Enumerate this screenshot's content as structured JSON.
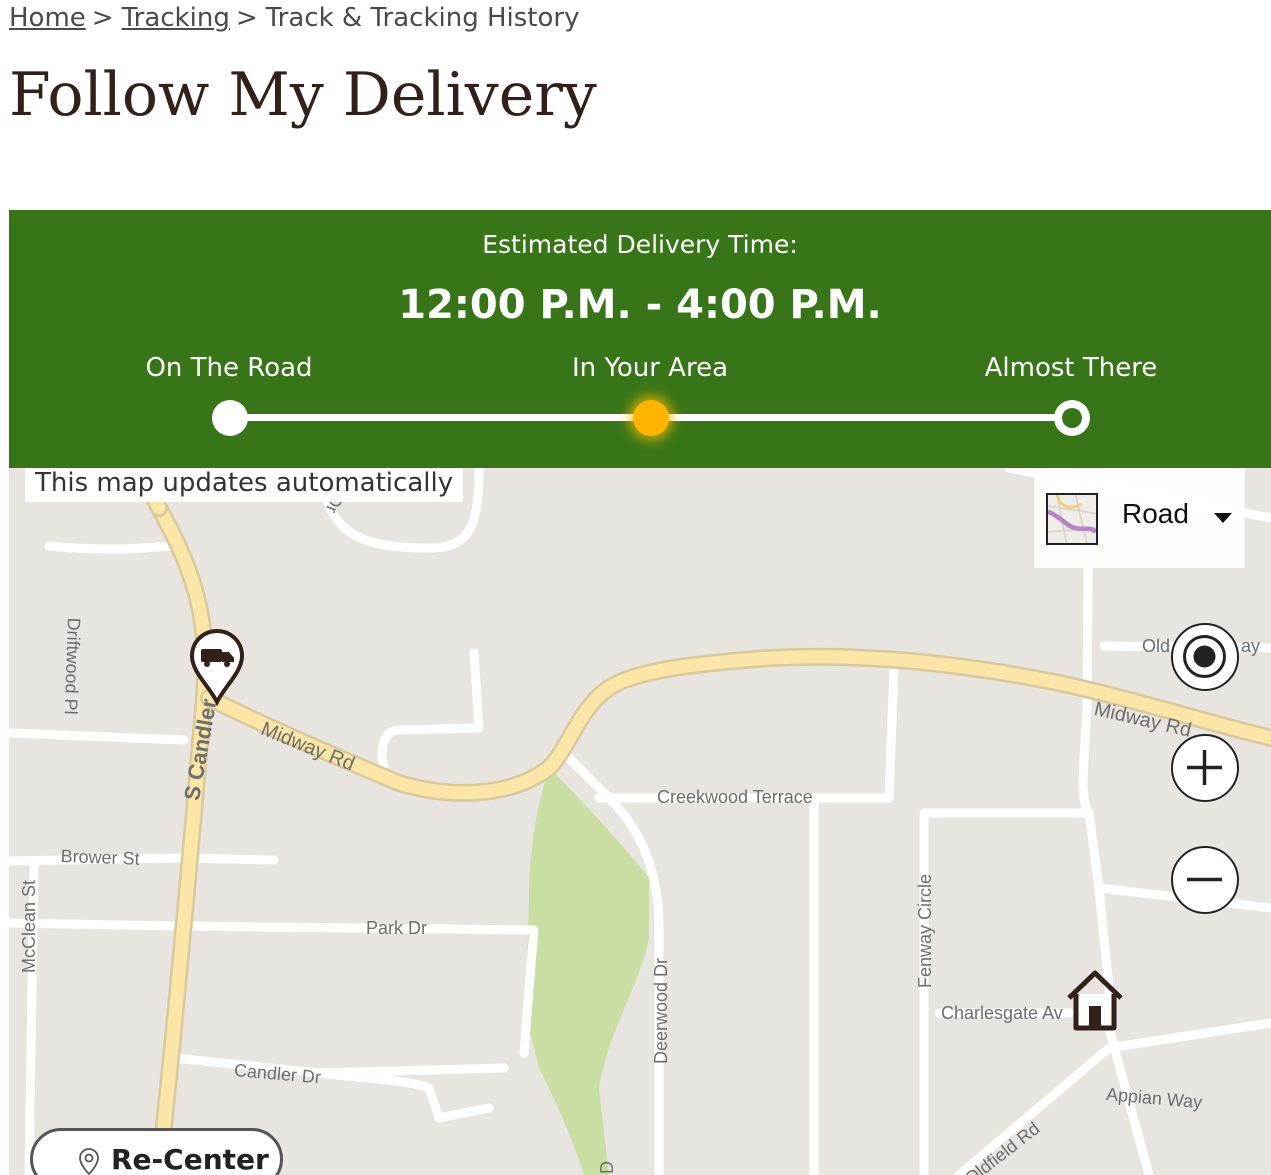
{
  "breadcrumb": {
    "home": "Home",
    "tracking": "Tracking",
    "current": "Track & Tracking History",
    "separator": ">"
  },
  "page": {
    "title": "Follow My Delivery"
  },
  "delivery": {
    "eta_label": "Estimated Delivery Time:",
    "eta_window": "12:00 P.M. - 4:00 P.M.",
    "stages": [
      "On The Road",
      "In Your Area",
      "Almost There"
    ],
    "current_stage_index": 1
  },
  "map": {
    "notice": "This map updates automatically",
    "map_type": "Road",
    "recenter_label": "Re-Center",
    "street_labels": {
      "s_candler": "S Candler",
      "midway_rd_west": "Midway Rd",
      "midway_rd_east": "Midway Rd",
      "driftwood_pl": "Driftwood Pl",
      "brower_st": "Brower St",
      "mcclean_st": "McClean St",
      "park_dr": "Park Dr",
      "candler_dr": "Candler Dr",
      "creekwood_terrace": "Creekwood Terrace",
      "deerwood_dr": "Deerwood Dr",
      "fenway_circle": "Fenway Circle",
      "charlesgate_av": "Charlesgate Av",
      "appian_way": "Appian Way",
      "oldfield_rd": "Oldfield Rd",
      "old": "Old",
      "ay": "ay",
      "dr_top": "Dr",
      "d_bottom": "D"
    }
  },
  "colors": {
    "brand_brown": "#332019",
    "eta_green": "#387518",
    "current_stage": "#ffb400",
    "map_bg": "#e8e5e0",
    "major_road": "#fbe6a8",
    "park": "#c9dea2"
  }
}
